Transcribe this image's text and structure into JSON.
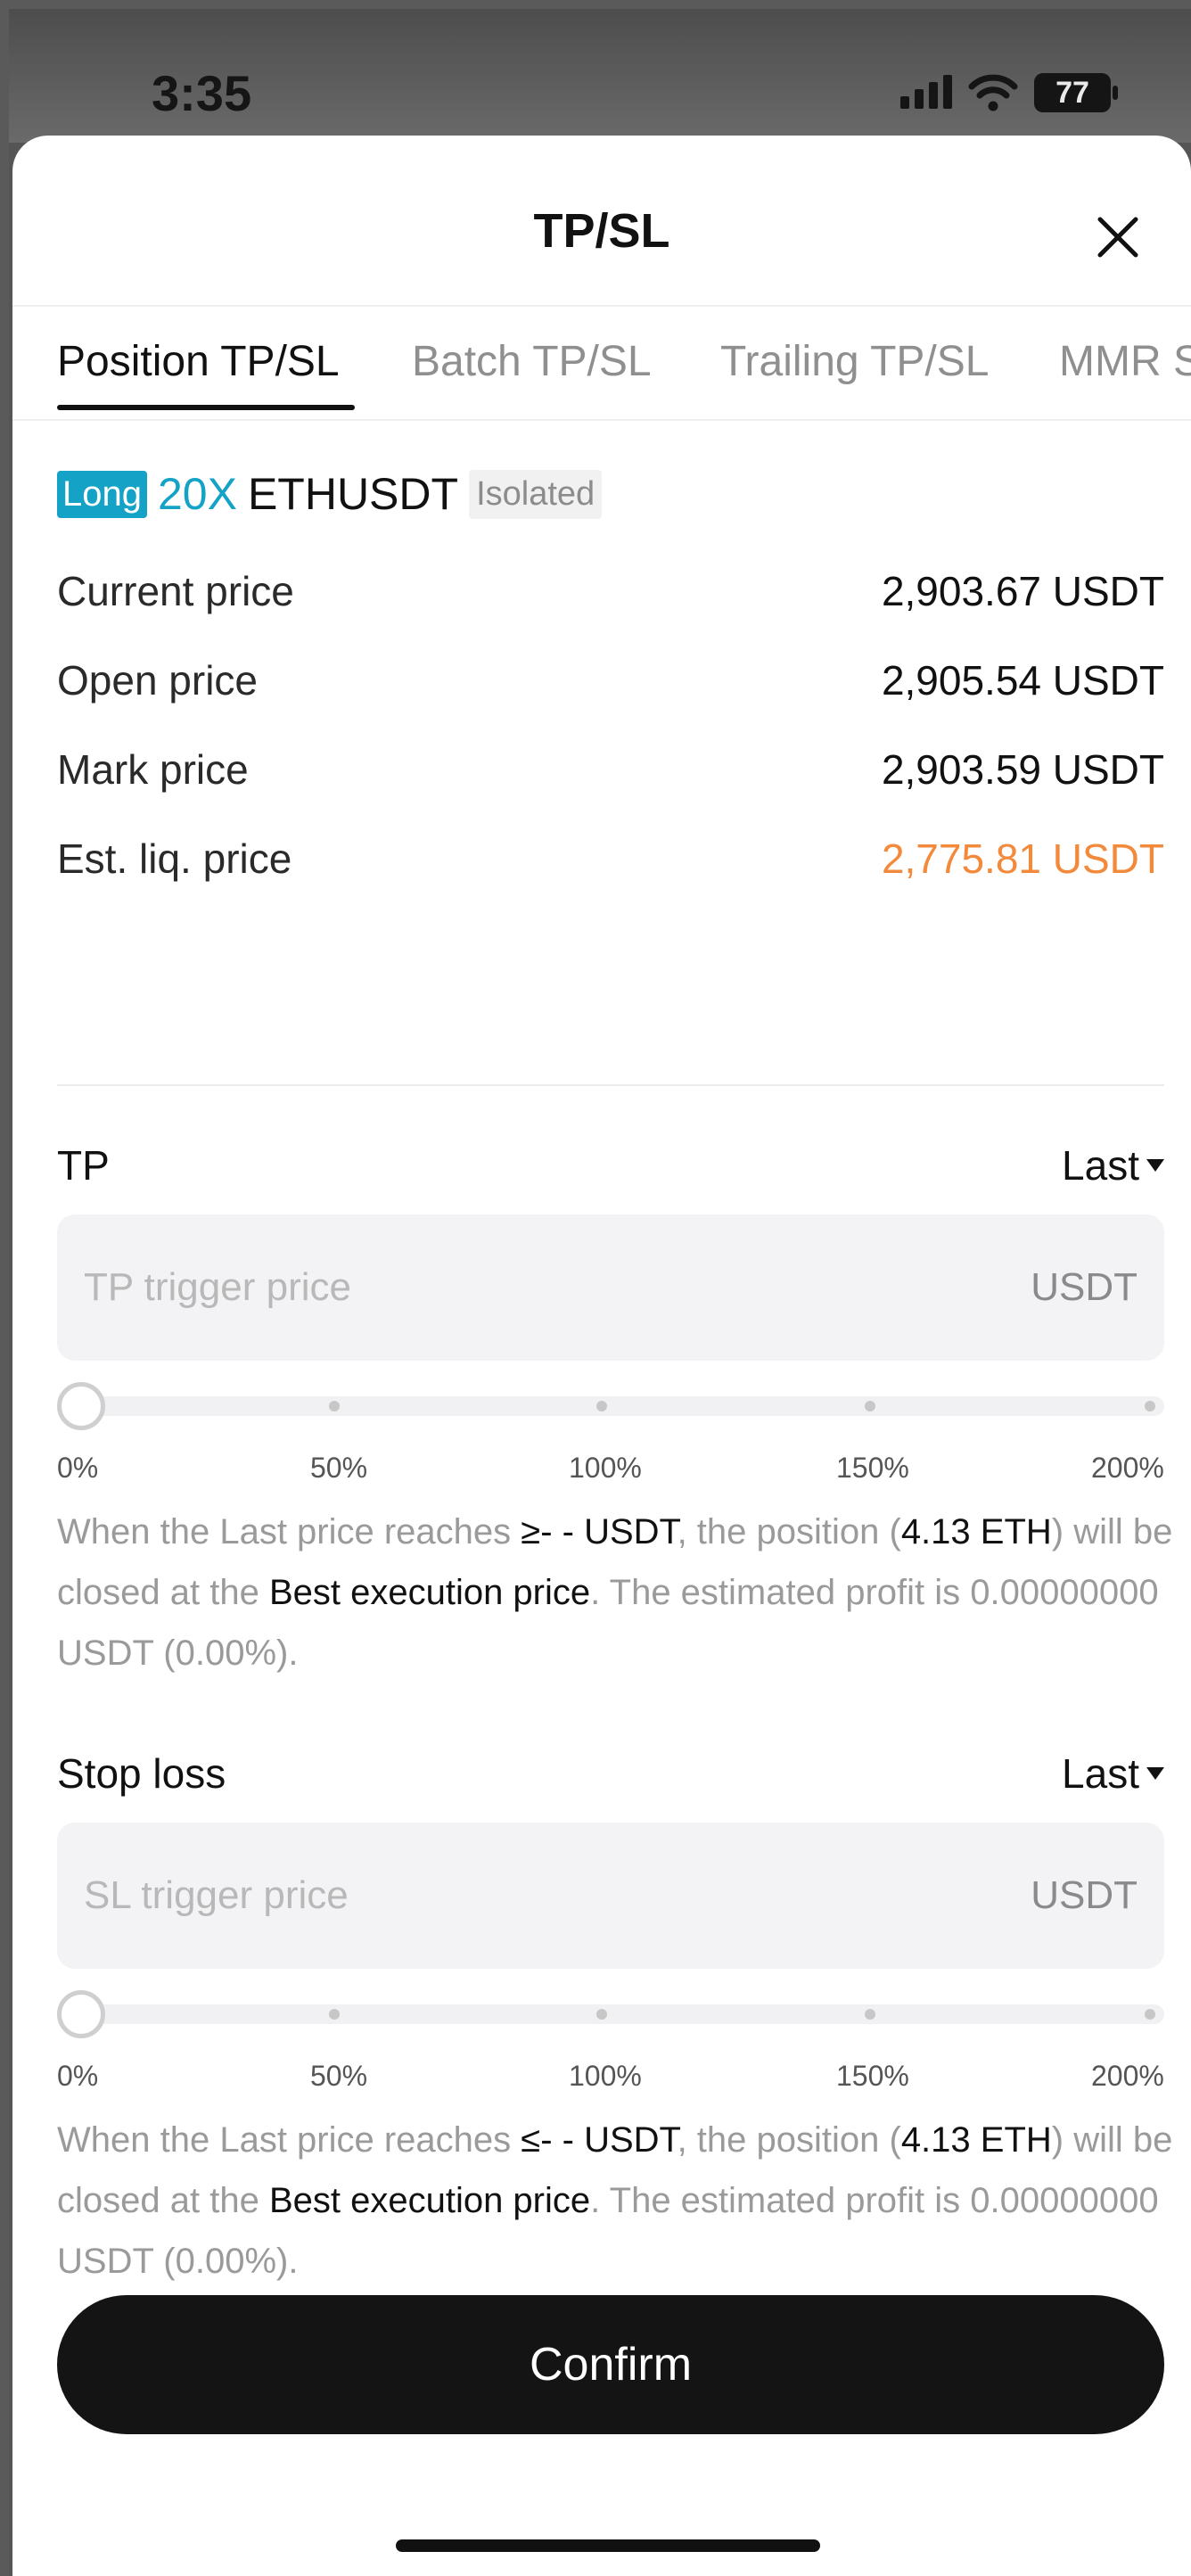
{
  "status_bar": {
    "time": "3:35",
    "battery": "77"
  },
  "header": {
    "title": "TP/SL"
  },
  "tabs": [
    {
      "label": "Position TP/SL"
    },
    {
      "label": "Batch TP/SL"
    },
    {
      "label": "Trailing TP/SL"
    },
    {
      "label": "MMR S"
    }
  ],
  "position": {
    "side": "Long",
    "leverage": "20X",
    "symbol": "ETHUSDT",
    "margin_mode": "Isolated"
  },
  "prices": [
    {
      "label": "Current price",
      "value": "2,903.67 USDT"
    },
    {
      "label": "Open price",
      "value": "2,905.54 USDT"
    },
    {
      "label": "Mark price",
      "value": "2,903.59 USDT"
    },
    {
      "label": "Est. liq. price",
      "value": "2,775.81 USDT"
    }
  ],
  "tp": {
    "label": "TP",
    "price_type": "Last",
    "placeholder": "TP trigger price",
    "value": "",
    "unit": "USDT",
    "slider_value_pct": 0,
    "slider_ticks": [
      "0%",
      "50%",
      "100%",
      "150%",
      "200%"
    ],
    "desc": {
      "p1": "When the Last price reaches ",
      "trigger": "≥- - USDT",
      "p2": ", the position (",
      "size": "4.13 ETH",
      "p3": ") will be closed at the ",
      "exec": "Best execution price",
      "p4": ". The estimated profit is 0.00000000 USDT (0.00%)."
    }
  },
  "sl": {
    "label": "Stop loss",
    "price_type": "Last",
    "placeholder": "SL trigger price",
    "value": "",
    "unit": "USDT",
    "slider_value_pct": 0,
    "slider_ticks": [
      "0%",
      "50%",
      "100%",
      "150%",
      "200%"
    ],
    "desc": {
      "p1": "When the Last price reaches ",
      "trigger": "≤- - USDT",
      "p2": ", the position (",
      "size": "4.13 ETH",
      "p3": ") will be closed at the ",
      "exec": "Best execution price",
      "p4": ". The estimated profit is 0.00000000 USDT (0.00%)."
    }
  },
  "confirm_label": "Confirm",
  "colors": {
    "accent": "#14a3c6",
    "liq": "#f3893a",
    "button": "#141414"
  }
}
